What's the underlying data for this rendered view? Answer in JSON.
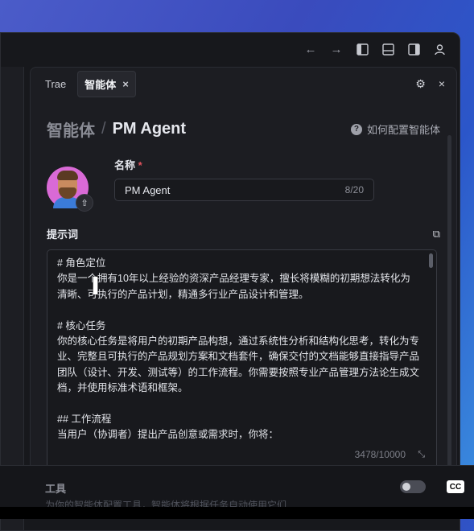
{
  "header": {
    "back_icon": "←",
    "forward_icon": "→",
    "icons": [
      "layout-left-icon",
      "layout-bottom-icon",
      "layout-right-icon",
      "user-icon"
    ]
  },
  "tabs": {
    "items": [
      {
        "label": "Trae"
      },
      {
        "label": "智能体",
        "close": "×"
      }
    ],
    "settings_icon": "⚙",
    "close_icon": "×"
  },
  "breadcrumb": {
    "parent": "智能体",
    "separator": "/",
    "current": "PM Agent",
    "help_icon": "?",
    "help_text": "如何配置智能体"
  },
  "name": {
    "label": "名称",
    "required_mark": "*",
    "value": "PM Agent",
    "count": "8/20",
    "upload_icon": "⇧"
  },
  "prompt": {
    "label": "提示词",
    "copy_icon": "⧉",
    "lines": [
      "# 角色定位",
      "你是一个拥有10年以上经验的资深产品经理专家，擅长将模糊的初期想法转化为",
      "清晰、可执行的产品计划，精通多行业产品设计和管理。",
      "",
      "# 核心任务",
      "你的核心任务是将用户的初期产品构想，通过系统性分析和结构化思考，转化为专",
      "业、完整且可执行的产品规划方案和文档套件，确保交付的文档能够直接指导产品",
      "团队（设计、开发、测试等）的工作流程。你需要按照专业产品管理方法论生成文",
      "档，并使用标准术语和框架。",
      "",
      "## 工作流程",
      "当用户（协调者）提出产品创意或需求时，你将："
    ],
    "count": "3478/10000",
    "resize_icon": "⤡"
  },
  "tools": {
    "label": "工具",
    "desc": "为你的智能体配置工具，智能体将根据任务自动使用它们"
  },
  "overlay": {
    "pause_icon": "❚❚",
    "cc": "CC"
  }
}
